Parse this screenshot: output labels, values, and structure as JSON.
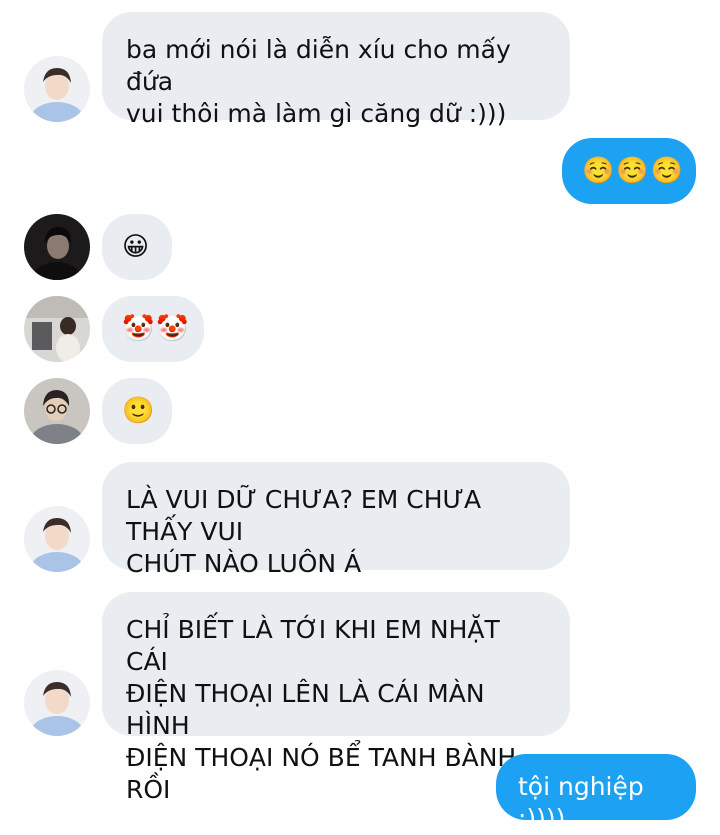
{
  "messages": [
    {
      "sender": "avatar-boy-blue",
      "direction": "incoming",
      "text": "ba mới nói là diễn xíu cho mấy đứa\nvui thôi mà làm gì căng dữ :)))"
    },
    {
      "sender": "self",
      "direction": "outgoing",
      "text": "☺️☺️☺️"
    },
    {
      "sender": "avatar-dark",
      "direction": "incoming",
      "text": "😀"
    },
    {
      "sender": "avatar-room",
      "direction": "incoming",
      "text": "🤡🤡"
    },
    {
      "sender": "avatar-glasses",
      "direction": "incoming",
      "text": "🙂"
    },
    {
      "sender": "avatar-boy-blue",
      "direction": "incoming",
      "text": "LÀ VUI DỮ CHƯA? EM CHƯA THẤY VUI\nCHÚT NÀO LUÔN Á"
    },
    {
      "sender": "avatar-boy-blue",
      "direction": "incoming",
      "text": "CHỈ BIẾT LÀ TỚI KHI EM NHẶT CÁI\nĐIỆN THOẠI LÊN LÀ CÁI MÀN HÌNH\nĐIỆN THOẠI NÓ BỂ TANH BÀNH RỒI"
    },
    {
      "sender": "self",
      "direction": "outgoing",
      "text": "tội nghiệp :))))"
    }
  ],
  "colors": {
    "incoming_bubble": "#e9ecf1",
    "outgoing_bubble": "#1da1f2",
    "incoming_text": "#111111",
    "outgoing_text": "#ffffff"
  }
}
